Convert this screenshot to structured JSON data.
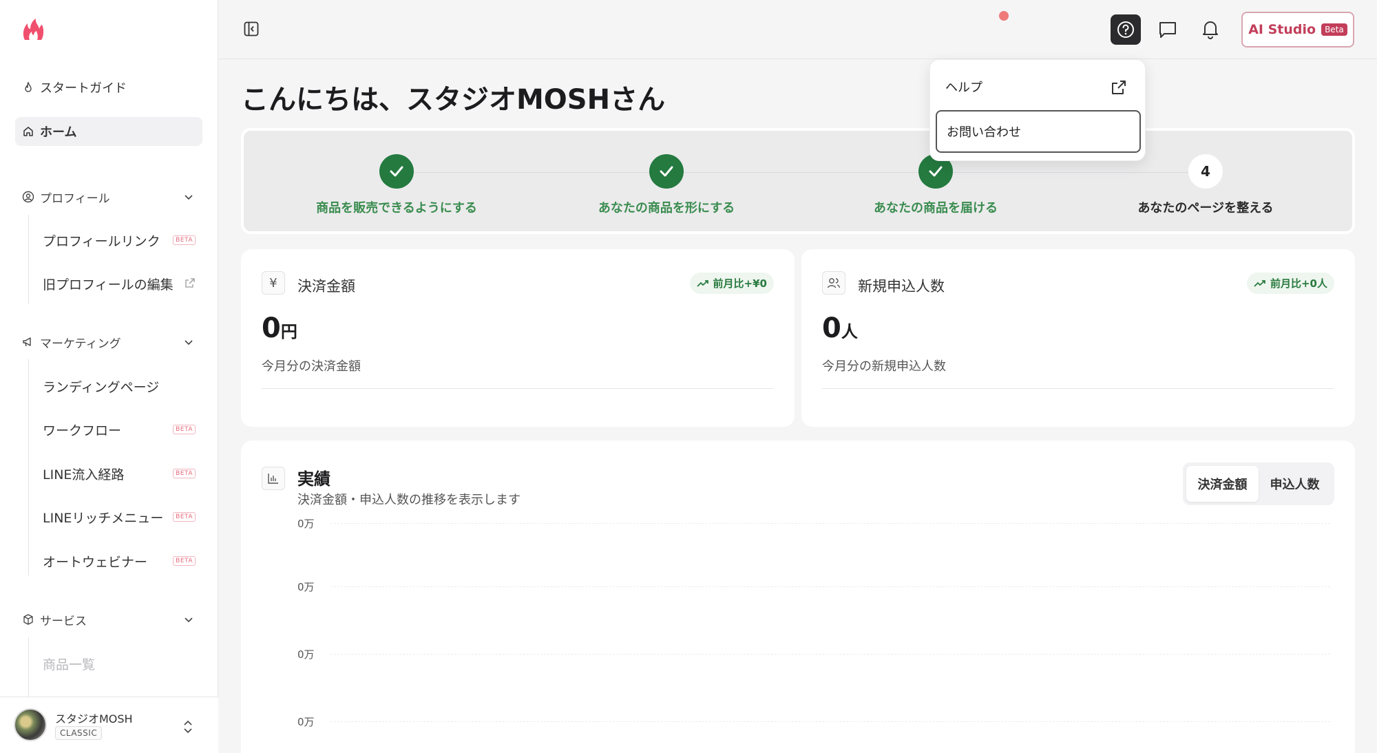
{
  "sidebar": {
    "start_guide": "スタートガイド",
    "home": "ホーム",
    "profile_section": "プロフィール",
    "profile_link": "プロフィールリンク",
    "old_profile": "旧プロフィールの編集",
    "marketing_section": "マーケティング",
    "landing_page": "ランディングページ",
    "workflow": "ワークフロー",
    "line_route": "LINE流入経路",
    "line_rich": "LINEリッチメニュー",
    "auto_webinar": "オートウェビナー",
    "service_section": "サービス",
    "product_list": "商品一覧",
    "beta": "BETA",
    "user_name": "スタジオMOSH",
    "user_plan": "CLASSIC"
  },
  "header": {
    "ai_studio": "AI Studio",
    "ai_beta": "Beta"
  },
  "dropdown": {
    "help": "ヘルプ",
    "contact": "お問い合わせ"
  },
  "greeting": "こんにちは、スタジオMOSHさん",
  "steps": [
    {
      "label": "商品を販売できるようにする",
      "done": true
    },
    {
      "label": "あなたの商品を形にする",
      "done": true
    },
    {
      "label": "あなたの商品を届ける",
      "done": true
    },
    {
      "label": "あなたのページを整える",
      "done": false,
      "number": "4"
    }
  ],
  "stats": {
    "payment": {
      "icon": "¥",
      "title": "決済金額",
      "chip": "前月比+¥0",
      "value": "0",
      "unit": "円",
      "desc": "今月分の決済金額"
    },
    "applicants": {
      "title": "新規申込人数",
      "chip": "前月比+0人",
      "value": "0",
      "unit": "人",
      "desc": "今月分の新規申込人数"
    }
  },
  "chart": {
    "title": "実績",
    "subtitle": "決済金額・申込人数の推移を表示します",
    "tab_payment": "決済金額",
    "tab_applicants": "申込人数",
    "y_ticks": [
      "0万",
      "0万",
      "0万",
      "0万"
    ]
  },
  "colors": {
    "accent_green": "#247a3f",
    "brand_pink": "#c23e5a"
  }
}
